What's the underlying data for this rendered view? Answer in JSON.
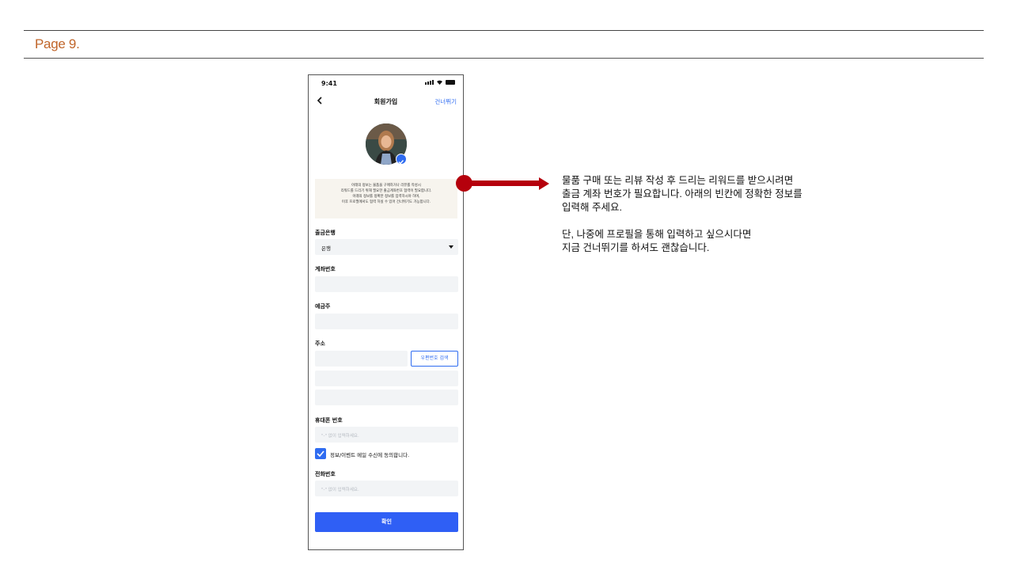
{
  "page": {
    "label": "Page 9."
  },
  "phone": {
    "status_time": "9:41",
    "nav": {
      "title": "회원가입",
      "skip": "건너뛰기"
    },
    "notice": [
      "아래의 정보는 물품을 구매하거나 리뷰를 작성시",
      "리워드를 드리기 위해 필요한 출금계좌번호 협력이 필요합니다.",
      "아래의 정보를 정확한 정보를 입력하시야 하며,",
      "이후 프로필에서도 협력 하실 수 있어 건너뛰기도 가능합니다."
    ],
    "bank": {
      "label": "출금은행",
      "value": "은행"
    },
    "account": {
      "label": "계좌번호"
    },
    "holder": {
      "label": "예금주"
    },
    "address": {
      "label": "주소",
      "zip_button": "우편번호 검색"
    },
    "mobile": {
      "label": "휴대폰 번호",
      "placeholder": "\"-\" 없이 입력하세요."
    },
    "agree": {
      "label": "정보/이벤트 메일 수신에 동의합니다.",
      "checked": true
    },
    "phone_num": {
      "label": "전화번호",
      "placeholder": "\"-\" 없이 입력하세요."
    },
    "confirm": "확인",
    "colors": {
      "accent": "#2f6cf1",
      "button": "#2f5ff5",
      "field": "#f2f4f6",
      "notice_bg": "#f7f4ee"
    }
  },
  "annotation": {
    "color": "#b5000c",
    "lines": [
      "물품 구매 또는 리뷰 작성 후 드리는 리워드를 받으시려면",
      "출금 계좌 번호가 필요합니다. 아래의 빈칸에 정확한 정보를",
      "입력해 주세요.",
      "단, 나중에 프로필을 통해 입력하고 싶으시다면",
      "지금 건너뛰기를 하셔도 괜찮습니다."
    ]
  }
}
